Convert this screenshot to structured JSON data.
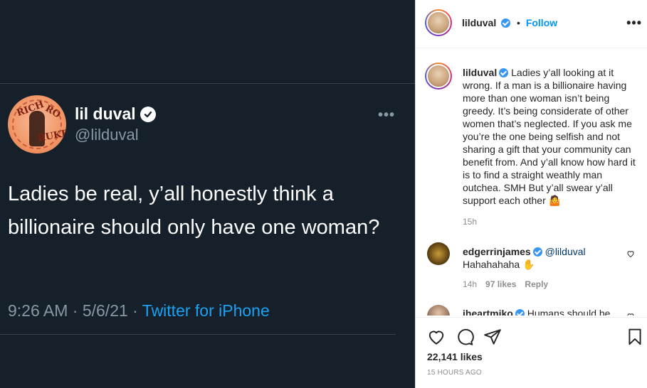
{
  "tweet": {
    "display_name": "lil duval",
    "handle": "@lilduval",
    "more": "•••",
    "text": "Ladies be real, y’all honestly think a billionaire should only have one woman?",
    "time_date": "9:26 AM · 5/6/21 · ",
    "source": "Twitter for iPhone",
    "avatar_text": [
      "RICH",
      "RO",
      "RUKE"
    ]
  },
  "header": {
    "username": "lilduval",
    "dot": "•",
    "follow": "Follow",
    "more": "•••"
  },
  "caption": {
    "username": "lilduval",
    "text": "Ladies y’all looking at it wrong. If a man is a billionaire having more than one woman isn’t being greedy. It’s being considerate of other women that’s neglected. If you ask me you’re the one being selfish and not sharing a gift that your community can benefit from. And y’all know how hard it is to find a straight weathly man outchea. SMH But y’all swear y’all support each other 🤷",
    "time": "15h"
  },
  "comments": [
    {
      "username": "edgerrinjames",
      "mention": "@lilduval",
      "text": "Hahahahaha ✋",
      "time": "14h",
      "likes": "97 likes",
      "reply": "Reply"
    },
    {
      "username": "iheartmiko",
      "text": "Humans should be",
      "time": "",
      "likes": "",
      "reply": ""
    }
  ],
  "actions": {
    "likes": "22,141 likes",
    "date": "15 HOURS AGO"
  },
  "colors": {
    "tweet_bg": "#15202b",
    "twitter_blue": "#1da1f2",
    "ig_blue": "#0095f6"
  }
}
